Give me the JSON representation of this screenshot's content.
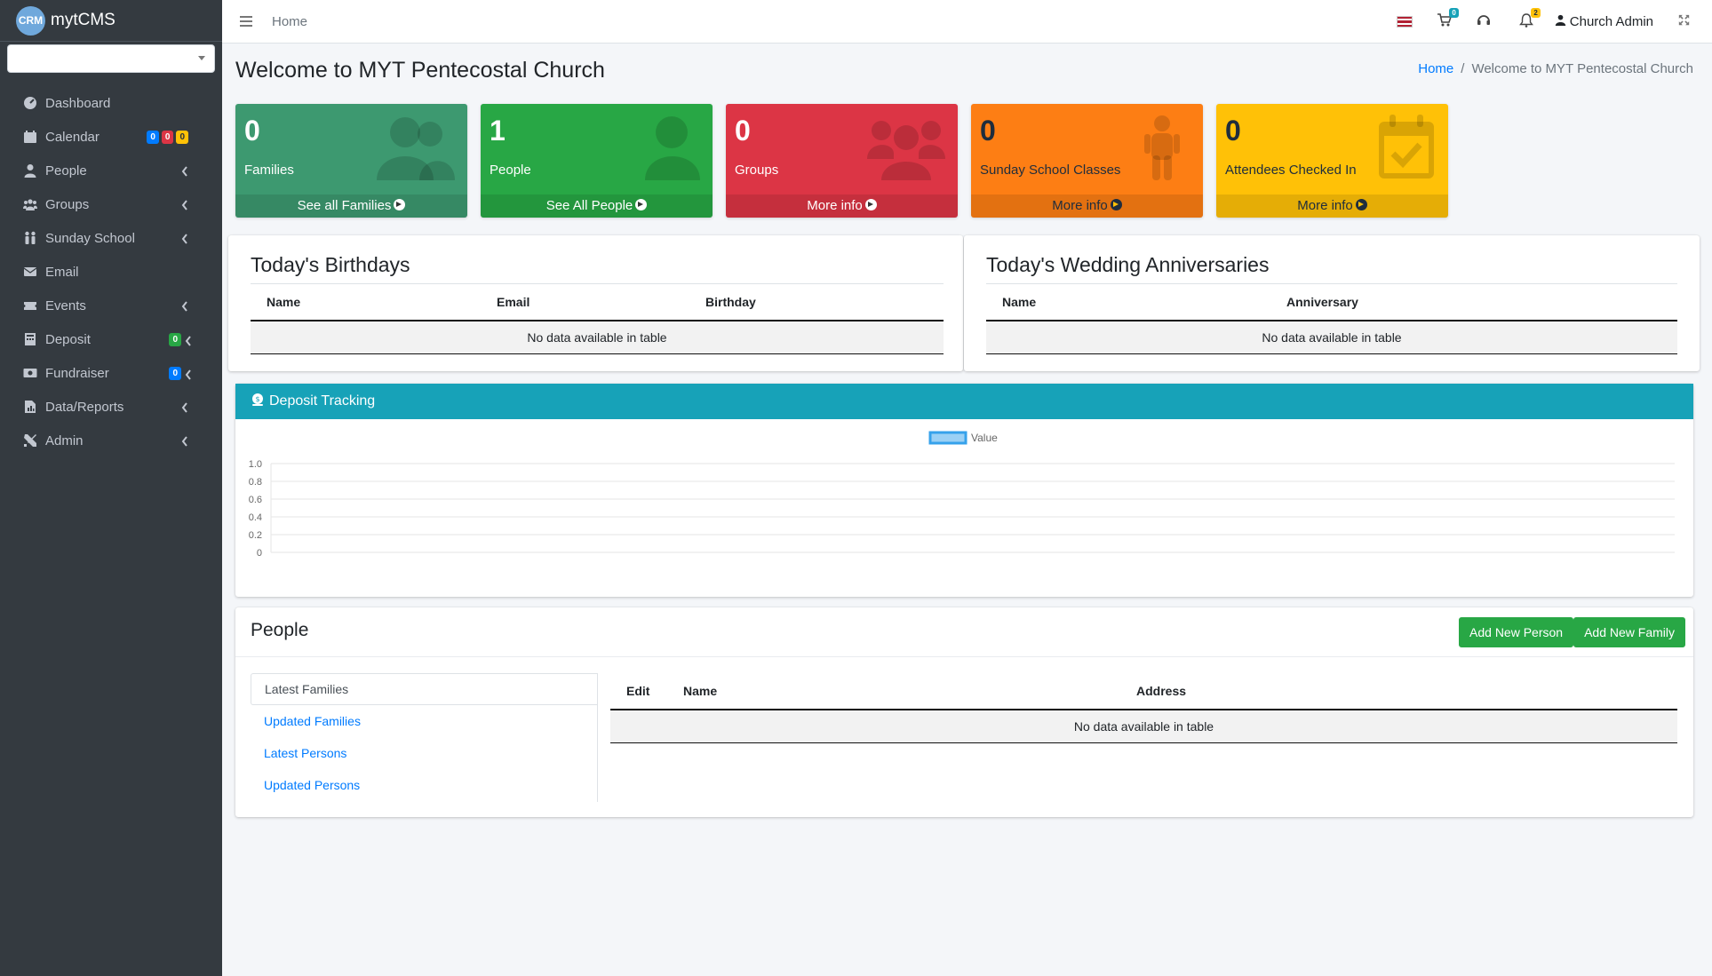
{
  "brand": {
    "logo_text": "CRM",
    "name": "mytCMS"
  },
  "sidebar": {
    "items": [
      {
        "label": "Dashboard",
        "icon": "dashboard-icon"
      },
      {
        "label": "Calendar",
        "icon": "calendar-icon",
        "badges": [
          "0",
          "0",
          "0"
        ]
      },
      {
        "label": "People",
        "icon": "user-icon"
      },
      {
        "label": "Groups",
        "icon": "users-icon"
      },
      {
        "label": "Sunday School",
        "icon": "child-icon"
      },
      {
        "label": "Email",
        "icon": "envelope-icon"
      },
      {
        "label": "Events",
        "icon": "ticket-icon"
      },
      {
        "label": "Deposit",
        "icon": "bank-icon",
        "badge": "0"
      },
      {
        "label": "Fundraiser",
        "icon": "money-icon",
        "badge": "0"
      },
      {
        "label": "Data/Reports",
        "icon": "report-icon"
      },
      {
        "label": "Admin",
        "icon": "tools-icon"
      }
    ]
  },
  "topbar": {
    "home": "Home",
    "cart_count": "0",
    "notif_count": "2",
    "user": "Church Admin"
  },
  "page": {
    "title": "Welcome to MYT Pentecostal Church",
    "breadcrumb": {
      "home": "Home",
      "current": "Welcome to MYT Pentecostal Church"
    }
  },
  "stats": [
    {
      "num": "0",
      "label": "Families",
      "link": "See all Families",
      "color": "#3d9970"
    },
    {
      "num": "1",
      "label": "People",
      "link": "See All People",
      "color": "#28a745"
    },
    {
      "num": "0",
      "label": "Groups",
      "link": "More info",
      "color": "#dc3545"
    },
    {
      "num": "0",
      "label": "Sunday School Classes",
      "link": "More info",
      "color": "#fd7e14"
    },
    {
      "num": "0",
      "label": "Attendees Checked In",
      "link": "More info",
      "color": "#ffc107"
    }
  ],
  "birthdays": {
    "title": "Today's Birthdays",
    "columns": [
      "Name",
      "Email",
      "Birthday"
    ],
    "empty": "No data available in table"
  },
  "anniversaries": {
    "title": "Today's Wedding Anniversaries",
    "columns": [
      "Name",
      "Anniversary"
    ],
    "empty": "No data available in table"
  },
  "deposit": {
    "title": "Deposit Tracking"
  },
  "chart_data": {
    "type": "bar",
    "categories": [],
    "series": [
      {
        "name": "Value",
        "values": []
      }
    ],
    "ylim": [
      0,
      1
    ],
    "yticks": [
      "1.0",
      "0.8",
      "0.6",
      "0.4",
      "0.2",
      "0"
    ],
    "legend": "top-center",
    "colors": {
      "series": "#9ad0f5",
      "border": "#36a2eb"
    }
  },
  "people": {
    "title": "People",
    "add_person": "Add New Person",
    "add_family": "Add New Family",
    "tabs": [
      "Latest Families",
      "Updated Families",
      "Latest Persons",
      "Updated Persons"
    ],
    "columns": [
      "Edit",
      "Name",
      "Address"
    ],
    "empty": "No data available in table"
  }
}
